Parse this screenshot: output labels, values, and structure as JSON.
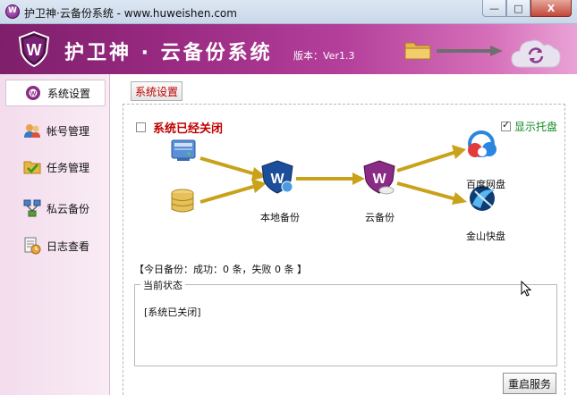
{
  "window": {
    "title": "护卫神·云备份系统 - www.huweishen.com",
    "app_icon_letter": "W",
    "minimize": "—",
    "maximize": "□",
    "close": "X"
  },
  "banner": {
    "brand": "护卫神 · 云备份系统",
    "version": "版本：Ver1.3",
    "accent": "#9a2a82"
  },
  "sidebar": {
    "items": [
      {
        "label": "系统设置",
        "icon": "gear-shield-icon",
        "active": true
      },
      {
        "label": "帐号管理",
        "icon": "users-icon",
        "active": false
      },
      {
        "label": "任务管理",
        "icon": "folder-check-icon",
        "active": false
      },
      {
        "label": "私云备份",
        "icon": "network-icon",
        "active": false
      },
      {
        "label": "日志查看",
        "icon": "log-clock-icon",
        "active": false
      }
    ]
  },
  "main": {
    "tab_label": "系统设置",
    "system_status": "系统已经关闭",
    "show_tray_label": "显示托盘",
    "show_tray_checked": true,
    "system_checked": false,
    "diagram": {
      "local_backup": "本地备份",
      "cloud_backup": "云备份",
      "baidu": "百度网盘",
      "kingsoft": "金山快盘"
    },
    "today_backup": "【今日备份：成功：0 条，失败 0 条 】",
    "current_state_legend": "当前状态",
    "current_state_text": "[系统已关闭]",
    "restart_button": "重启服务"
  },
  "colors": {
    "status_red": "#c00000",
    "tray_green": "#138a1f",
    "arrow_gold": "#c9a21a"
  }
}
